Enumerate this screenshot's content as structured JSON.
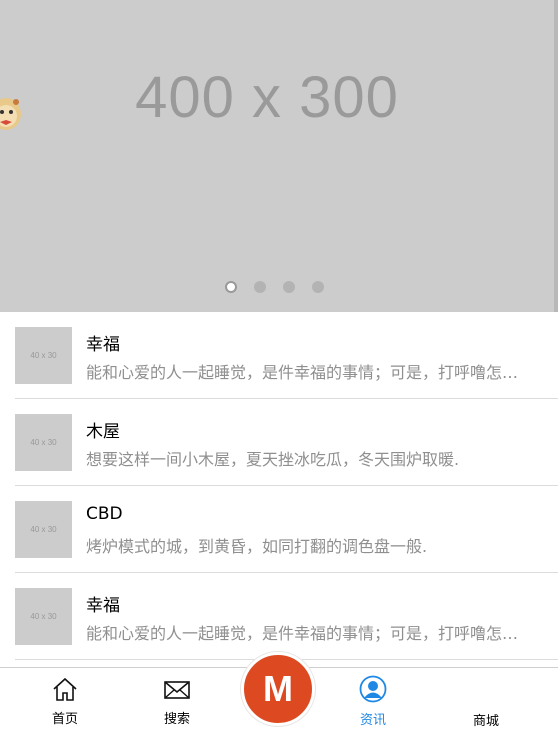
{
  "slider": {
    "placeholder_text": "400 x 300",
    "dots": [
      true,
      false,
      false,
      false
    ]
  },
  "list": {
    "thumb_placeholder": "40 x 30",
    "items": [
      {
        "title": "幸福",
        "desc": "能和心爱的人一起睡觉，是件幸福的事情；可是，打呼噜怎么办？"
      },
      {
        "title": "木屋",
        "desc": "想要这样一间小木屋，夏天挫冰吃瓜，冬天围炉取暖."
      },
      {
        "title": "CBD",
        "desc": "烤炉模式的城，到黄昏，如同打翻的调色盘一般."
      },
      {
        "title": "幸福",
        "desc": "能和心爱的人一起睡觉，是件幸福的事情；可是，打呼噜怎么办？"
      }
    ]
  },
  "tabbar": {
    "home": "首页",
    "search": "搜索",
    "center": "M",
    "news": "资讯",
    "mall": "商城",
    "active_color": "#1e88e5",
    "center_color": "#dd4a22"
  }
}
